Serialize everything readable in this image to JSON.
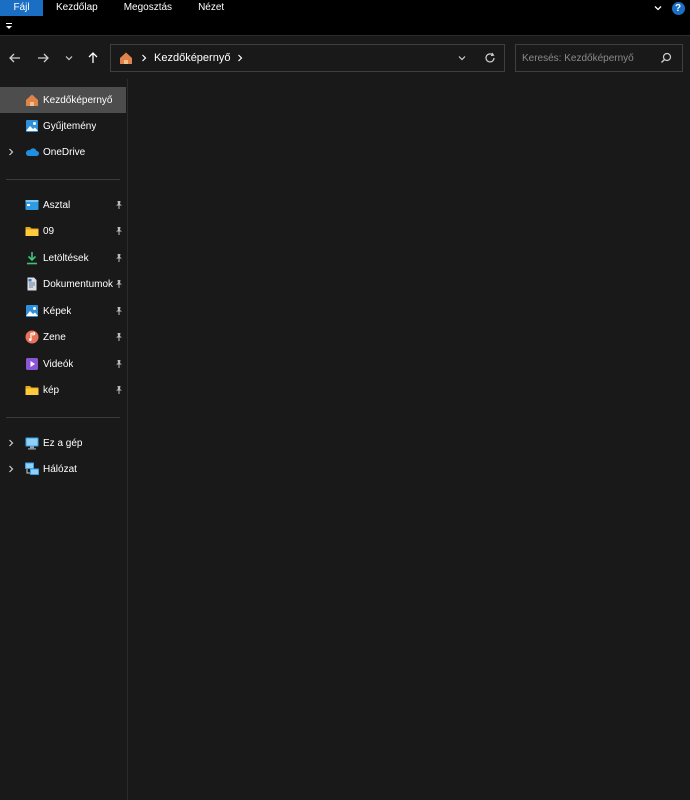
{
  "ribbon": {
    "tabs": [
      {
        "label": "Fájl",
        "active": true
      },
      {
        "label": "Kezdőlap"
      },
      {
        "label": "Megosztás"
      },
      {
        "label": "Nézet"
      }
    ],
    "help_label": "?",
    "accent": "#1a6fc4"
  },
  "toolbar": {
    "back_icon": "arrow-left-icon",
    "forward_icon": "arrow-right-icon",
    "recent_icon": "chevron-down-icon",
    "up_icon": "arrow-up-icon"
  },
  "address": {
    "crumbs": [
      "Kezdőképernyő"
    ],
    "dropdown_icon": "chevron-down-icon",
    "refresh_icon": "refresh-icon"
  },
  "search": {
    "placeholder": "Keresés: Kezdőképernyő",
    "value": ""
  },
  "sidebar": {
    "top_items": [
      {
        "label": "Kezdőképernyő",
        "icon": "home-icon",
        "selected": true
      },
      {
        "label": "Gyűjtemény",
        "icon": "gallery-icon"
      },
      {
        "label": "OneDrive",
        "icon": "onedrive-cloud-icon",
        "expandable": true
      }
    ],
    "pinned_items": [
      {
        "label": "Asztal",
        "icon": "desktop-folder-icon",
        "pinned": true
      },
      {
        "label": "09",
        "icon": "folder-icon",
        "pinned": true
      },
      {
        "label": "Letöltések",
        "icon": "download-icon",
        "pinned": true
      },
      {
        "label": "Dokumentumok",
        "icon": "documents-icon",
        "pinned": true
      },
      {
        "label": "Képek",
        "icon": "pictures-icon",
        "pinned": true
      },
      {
        "label": "Zene",
        "icon": "music-icon",
        "pinned": true
      },
      {
        "label": "Videók",
        "icon": "videos-icon",
        "pinned": true
      },
      {
        "label": "kép",
        "icon": "folder-icon",
        "pinned": true
      }
    ],
    "bottom_items": [
      {
        "label": "Ez a gép",
        "icon": "this-pc-icon",
        "expandable": true
      },
      {
        "label": "Hálózat",
        "icon": "network-icon",
        "expandable": true
      }
    ]
  }
}
